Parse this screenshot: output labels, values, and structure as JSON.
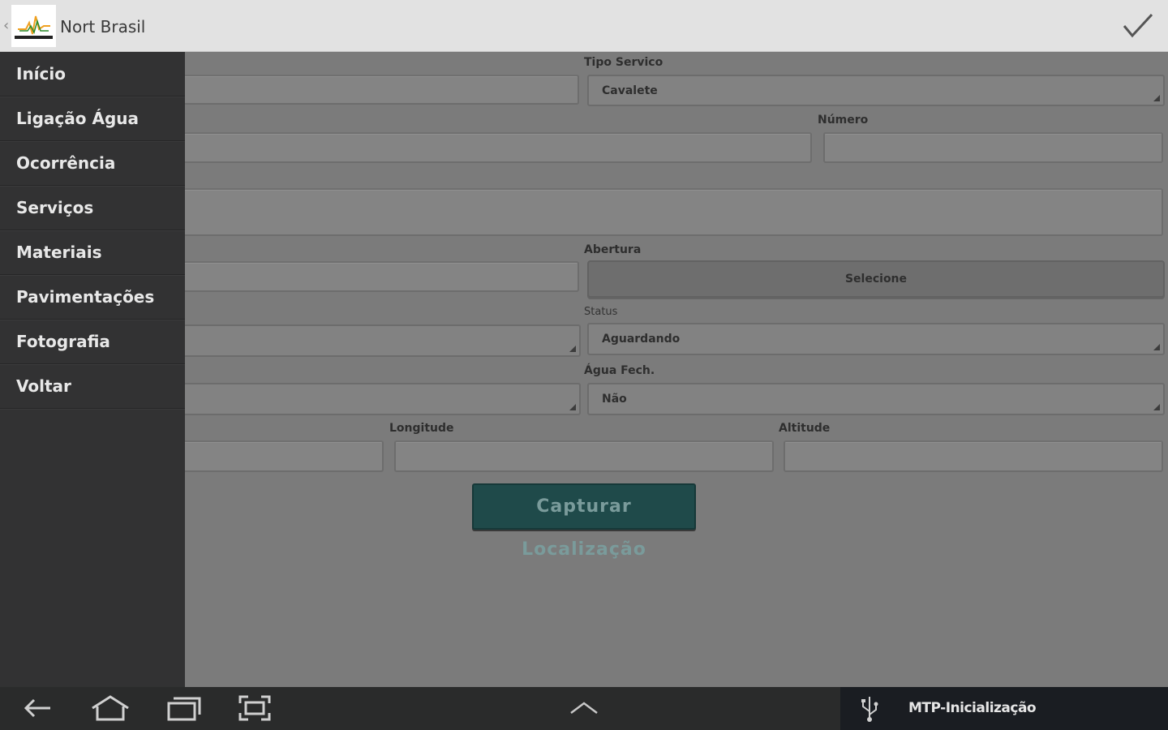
{
  "action_bar": {
    "title": "Nort Brasil",
    "logo_icon": "nort-brasil-logo",
    "confirm_icon": "check-icon"
  },
  "drawer": {
    "items": [
      {
        "label": "Início"
      },
      {
        "label": "Ligação Água"
      },
      {
        "label": "Ocorrência"
      },
      {
        "label": "Serviços"
      },
      {
        "label": "Materiais"
      },
      {
        "label": "Pavimentações"
      },
      {
        "label": "Fotografia"
      },
      {
        "label": "Voltar"
      }
    ]
  },
  "form": {
    "tipo_servico": {
      "label": "Tipo Servico",
      "value": "Cavalete"
    },
    "numero": {
      "label": "Número",
      "value": ""
    },
    "abertura": {
      "label": "Abertura",
      "button": "Selecione"
    },
    "status": {
      "label": "Status",
      "value": "Aguardando"
    },
    "agua_fech": {
      "label": "Água Fech.",
      "value": "Não"
    },
    "longitude": {
      "label": "Longitude",
      "value": ""
    },
    "altitude": {
      "label": "Altitude",
      "value": ""
    },
    "capture_button": "Capturar Localização"
  },
  "system_bar": {
    "icons": [
      "back-icon",
      "home-icon",
      "recent-apps-icon",
      "screenshot-icon",
      "menu-up-icon",
      "usb-icon"
    ],
    "notification": "MTP-Inicialização"
  },
  "colors": {
    "drawer_bg": "#323233",
    "action_bar_bg": "#e2e2e2",
    "dim_overlay": "#7b7b7b",
    "capture_button": "#1f4a4a",
    "system_bar": "#2a2b2b"
  }
}
